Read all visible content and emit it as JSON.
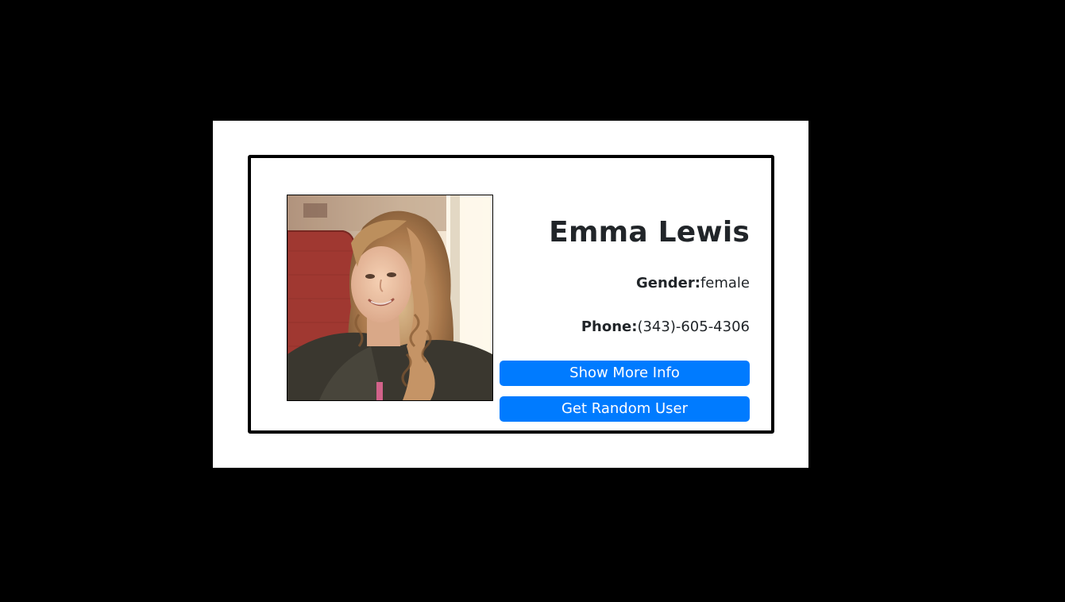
{
  "user": {
    "name": "Emma Lewis",
    "gender_label": "Gender:",
    "gender": "female",
    "phone_label": "Phone:",
    "phone": "(343)-605-4306",
    "photo_alt": "Emma Lewis"
  },
  "actions": {
    "show_more_label": "Show More Info",
    "random_user_label": "Get Random User"
  },
  "colors": {
    "background": "#000000",
    "panel": "#ffffff",
    "card_border": "#000000",
    "button": "#007bff",
    "button_text": "#ffffff",
    "text": "#212529"
  }
}
